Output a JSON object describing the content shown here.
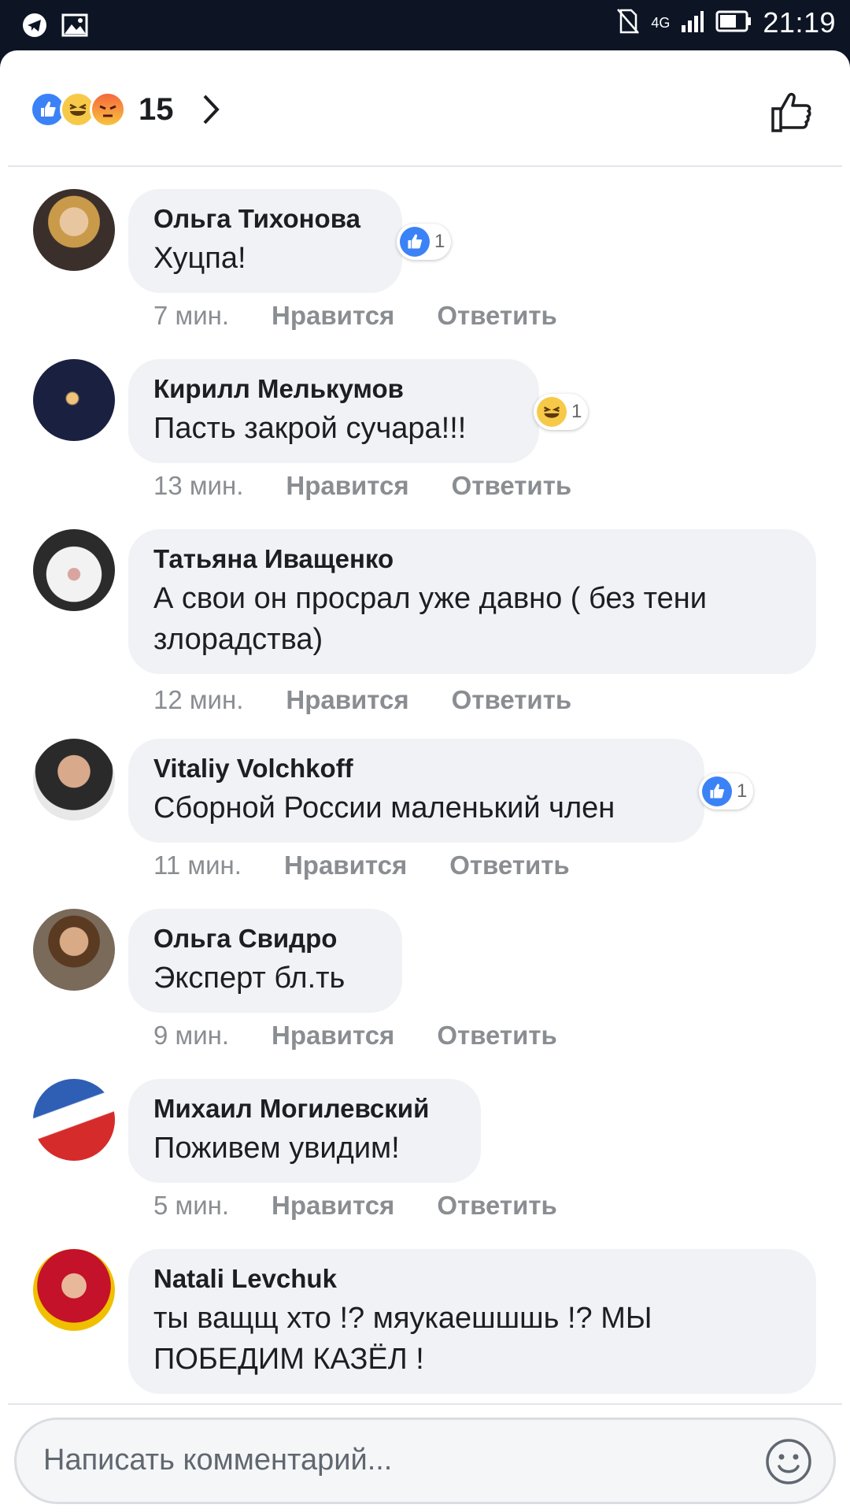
{
  "status_bar": {
    "network": "4G",
    "time": "21:19"
  },
  "reactions": {
    "types": [
      "like-icon",
      "haha-icon",
      "angry-icon"
    ],
    "count": "15"
  },
  "comments": [
    {
      "author": "Ольга Тихонова",
      "text": "Хуцпа!",
      "time": "7 мин.",
      "like_label": "Нравится",
      "reply_label": "Ответить",
      "reaction": "like-icon",
      "reaction_count": "1"
    },
    {
      "author": "Кирилл Мелькумов",
      "text": "Пасть закрой сучара!!!",
      "time": "13 мин.",
      "like_label": "Нравится",
      "reply_label": "Ответить",
      "reaction": "haha-icon",
      "reaction_count": "1"
    },
    {
      "author": "Татьяна Иващенко",
      "text": "А свои он просрал уже давно ( без тени злорадства)",
      "time": "12 мин.",
      "like_label": "Нравится",
      "reply_label": "Ответить"
    },
    {
      "author": "Vitaliy Volchkoff",
      "text": "Сборной России маленький член",
      "time": "11 мин.",
      "like_label": "Нравится",
      "reply_label": "Ответить",
      "reaction": "like-icon",
      "reaction_count": "1"
    },
    {
      "author": "Ольга Свидро",
      "text": "Эксперт бл.ть",
      "time": "9 мин.",
      "like_label": "Нравится",
      "reply_label": "Ответить"
    },
    {
      "author": "Михаил Могилевский",
      "text": "Поживем увидим!",
      "time": "5 мин.",
      "like_label": "Нравится",
      "reply_label": "Ответить"
    },
    {
      "author": "Natali Levchuk",
      "text": "ты ващщ хто !?  мяукаешшшь !?  МЫ ПОБЕДИМ КАЗЁЛ !"
    }
  ],
  "composer": {
    "placeholder": "Написать комментарий..."
  },
  "colors": {
    "accent": "#3b82f6",
    "bubble": "#f0f2f5",
    "meta": "#8a8d91"
  }
}
